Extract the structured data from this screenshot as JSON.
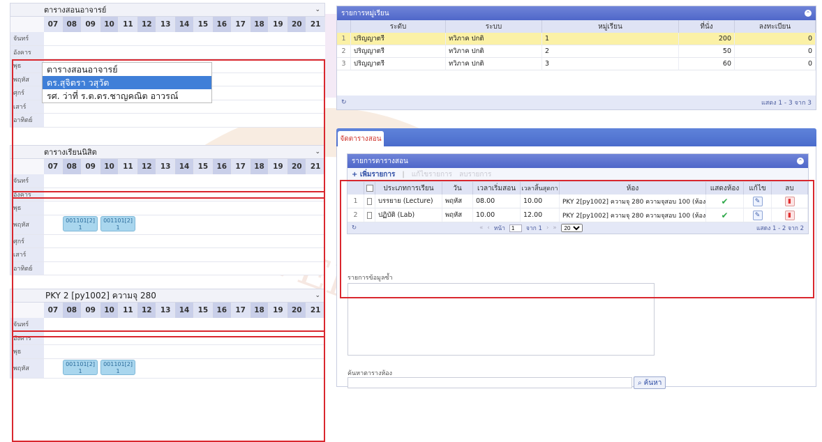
{
  "schedule_teacher": {
    "header": "ตารางสอนอาจารย์",
    "hours": [
      "07",
      "08",
      "09",
      "10",
      "11",
      "12",
      "13",
      "14",
      "15",
      "16",
      "17",
      "18",
      "19",
      "20",
      "21"
    ],
    "days": [
      "จันทร์",
      "อังคาร",
      "พุธ",
      "พฤหัส",
      "ศุกร์",
      "เสาร์",
      "อาทิตย์"
    ],
    "dropdown": {
      "options": [
        "ตารางสอนอาจารย์",
        "ดร.สุจิตรา วสุวัต",
        "รศ. ว่าที่ ร.ต.ดร.ชาญคณิต อาวรณ์"
      ],
      "selected_index": 1
    }
  },
  "schedule_student": {
    "header": "ตารางเรียนนิสิต",
    "days": [
      "จันทร์",
      "อังคาร",
      "พุธ",
      "พฤหัส",
      "ศุกร์",
      "เสาร์",
      "อาทิตย์"
    ],
    "slots": [
      {
        "code": "001101[2]",
        "sub": "1"
      },
      {
        "code": "001101[2]",
        "sub": "1"
      }
    ]
  },
  "schedule_room": {
    "header": "PKY 2 [py1002] ความจุ 280",
    "days": [
      "จันทร์",
      "อังคาร",
      "พุธ",
      "พฤหัส"
    ],
    "slots": [
      {
        "code": "001101[2]",
        "sub": "1"
      },
      {
        "code": "001101[2]",
        "sub": "1"
      }
    ]
  },
  "sections_grid": {
    "title": "รายการหมู่เรียน",
    "columns": [
      "ระดับ",
      "ระบบ",
      "หมู่เรียน",
      "ที่นั่ง",
      "ลงทะเบียน"
    ],
    "rows": [
      {
        "n": "1",
        "level": "ปริญญาตรี",
        "system": "ทวิภาค ปกติ",
        "section": "1",
        "seats": "200",
        "registered": "0"
      },
      {
        "n": "2",
        "level": "ปริญญาตรี",
        "system": "ทวิภาค ปกติ",
        "section": "2",
        "seats": "50",
        "registered": "0"
      },
      {
        "n": "3",
        "level": "ปริญญาตรี",
        "system": "ทวิภาค ปกติ",
        "section": "3",
        "seats": "60",
        "registered": "0"
      }
    ],
    "footer_text": "แสดง 1 - 3 จาก 3"
  },
  "tab_label": "จัดตารางสอน",
  "teaching_grid": {
    "title": "รายการตารางสอน",
    "toolbar": {
      "add": "+ เพิ่มรายการ",
      "edit": "แก้ไขรายการ",
      "delete": "ลบรายการ"
    },
    "columns": [
      "ประเภทการเรียน",
      "วัน",
      "เวลาเริ่มสอน",
      "เวลาสิ้นสุดกา",
      "ห้อง",
      "แสดงห้อง",
      "แก้ไข",
      "ลบ"
    ],
    "rows": [
      {
        "n": "1",
        "type": "บรรยาย (Lecture)",
        "day": "พฤหัส",
        "start": "08.00",
        "end": "10.00",
        "room": "PKY 2[py1002] ความจุ 280 ความจุสอบ 100 (ห้อง"
      },
      {
        "n": "2",
        "type": "ปฏิบัติ (Lab)",
        "day": "พฤหัส",
        "start": "10.00",
        "end": "12.00",
        "room": "PKY 2[py1002] ความจุ 280 ความจุสอบ 100 (ห้อง"
      }
    ],
    "pager": {
      "page_label": "หน้า",
      "page_value": "1",
      "of_text": "จาก 1",
      "page_size": "20",
      "summary": "แสดง 1 - 2 จาก 2"
    }
  },
  "duplicate_label": "รายการข้อมูลซ้ำ",
  "room_search": {
    "label": "ค้นหาตารางห้อง",
    "button": "ค้นหา"
  },
  "colors": {
    "accent": "#4f67c9",
    "highlight_row": "#fbf1a6",
    "red_box": "#d9272e"
  }
}
